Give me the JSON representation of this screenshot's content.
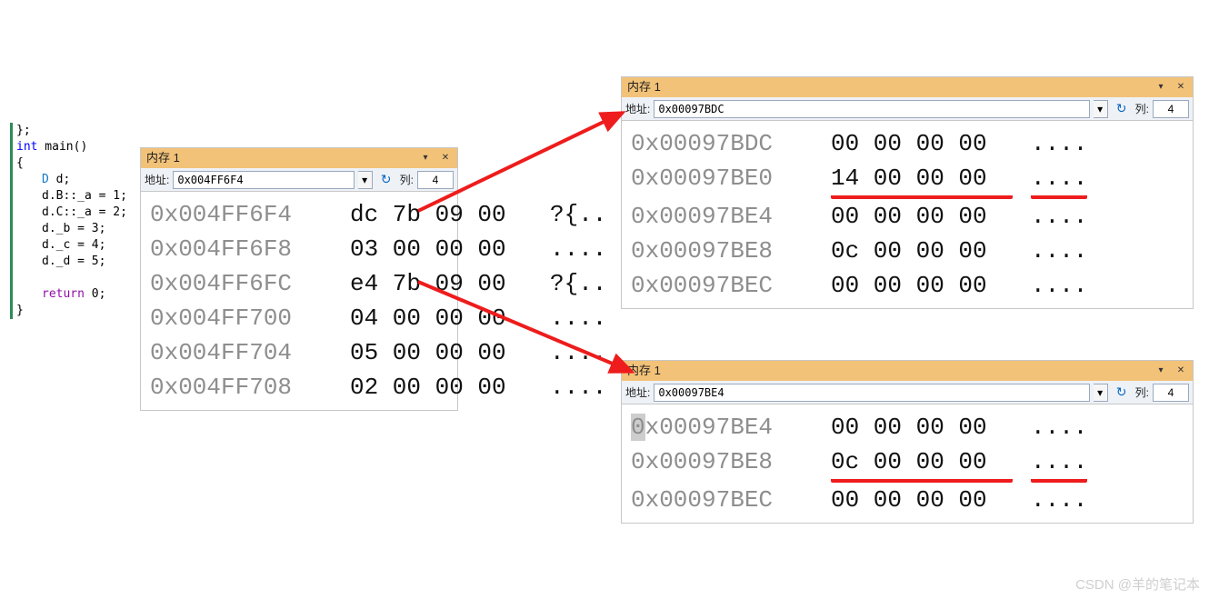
{
  "code": {
    "lines": [
      "};",
      "int main()",
      "{",
      "    D d;",
      "    d.B::_a = 1;",
      "    d.C::_a = 2;",
      "    d._b = 3;",
      "    d._c = 4;",
      "    d._d = 5;",
      "",
      "    return 0;",
      "}"
    ],
    "kw_int": "int",
    "name_main": " main()",
    "typ_D": "D",
    "ret": "return",
    "ret_val": " 0;"
  },
  "memwin1": {
    "title": "内存 1",
    "addr_label": "地址:",
    "addr_value": "0x004FF6F4",
    "cols_label": "列:",
    "cols_value": "4",
    "rows": [
      {
        "addr": "0x004FF6F4",
        "bytes": "dc 7b 09 00",
        "ascii": "?{.."
      },
      {
        "addr": "0x004FF6F8",
        "bytes": "03 00 00 00",
        "ascii": "...."
      },
      {
        "addr": "0x004FF6FC",
        "bytes": "e4 7b 09 00",
        "ascii": "?{.."
      },
      {
        "addr": "0x004FF700",
        "bytes": "04 00 00 00",
        "ascii": "...."
      },
      {
        "addr": "0x004FF704",
        "bytes": "05 00 00 00",
        "ascii": "...."
      },
      {
        "addr": "0x004FF708",
        "bytes": "02 00 00 00",
        "ascii": "...."
      }
    ]
  },
  "memwin2": {
    "title": "内存 1",
    "addr_label": "地址:",
    "addr_value": "0x00097BDC",
    "cols_label": "列:",
    "cols_value": "4",
    "rows": [
      {
        "addr": "0x00097BDC",
        "bytes": "00 00 00 00",
        "ascii": "...."
      },
      {
        "addr": "0x00097BE0",
        "bytes": "14 00 00 00",
        "ascii": "....",
        "underline": true
      },
      {
        "addr": "0x00097BE4",
        "bytes": "00 00 00 00",
        "ascii": "...."
      },
      {
        "addr": "0x00097BE8",
        "bytes": "0c 00 00 00",
        "ascii": "...."
      },
      {
        "addr": "0x00097BEC",
        "bytes": "00 00 00 00",
        "ascii": "...."
      }
    ]
  },
  "memwin3": {
    "title": "内存 1",
    "addr_label": "地址:",
    "addr_value": "0x00097BE4",
    "cols_label": "列:",
    "cols_value": "4",
    "rows": [
      {
        "addr": "0x00097BE4",
        "bytes": "00 00 00 00",
        "ascii": "....",
        "highlightFirst": true
      },
      {
        "addr": "0x00097BE8",
        "bytes": "0c 00 00 00",
        "ascii": "....",
        "underline": true
      },
      {
        "addr": "0x00097BEC",
        "bytes": "00 00 00 00",
        "ascii": "...."
      }
    ]
  },
  "watermark": "CSDN @羊的笔记本"
}
